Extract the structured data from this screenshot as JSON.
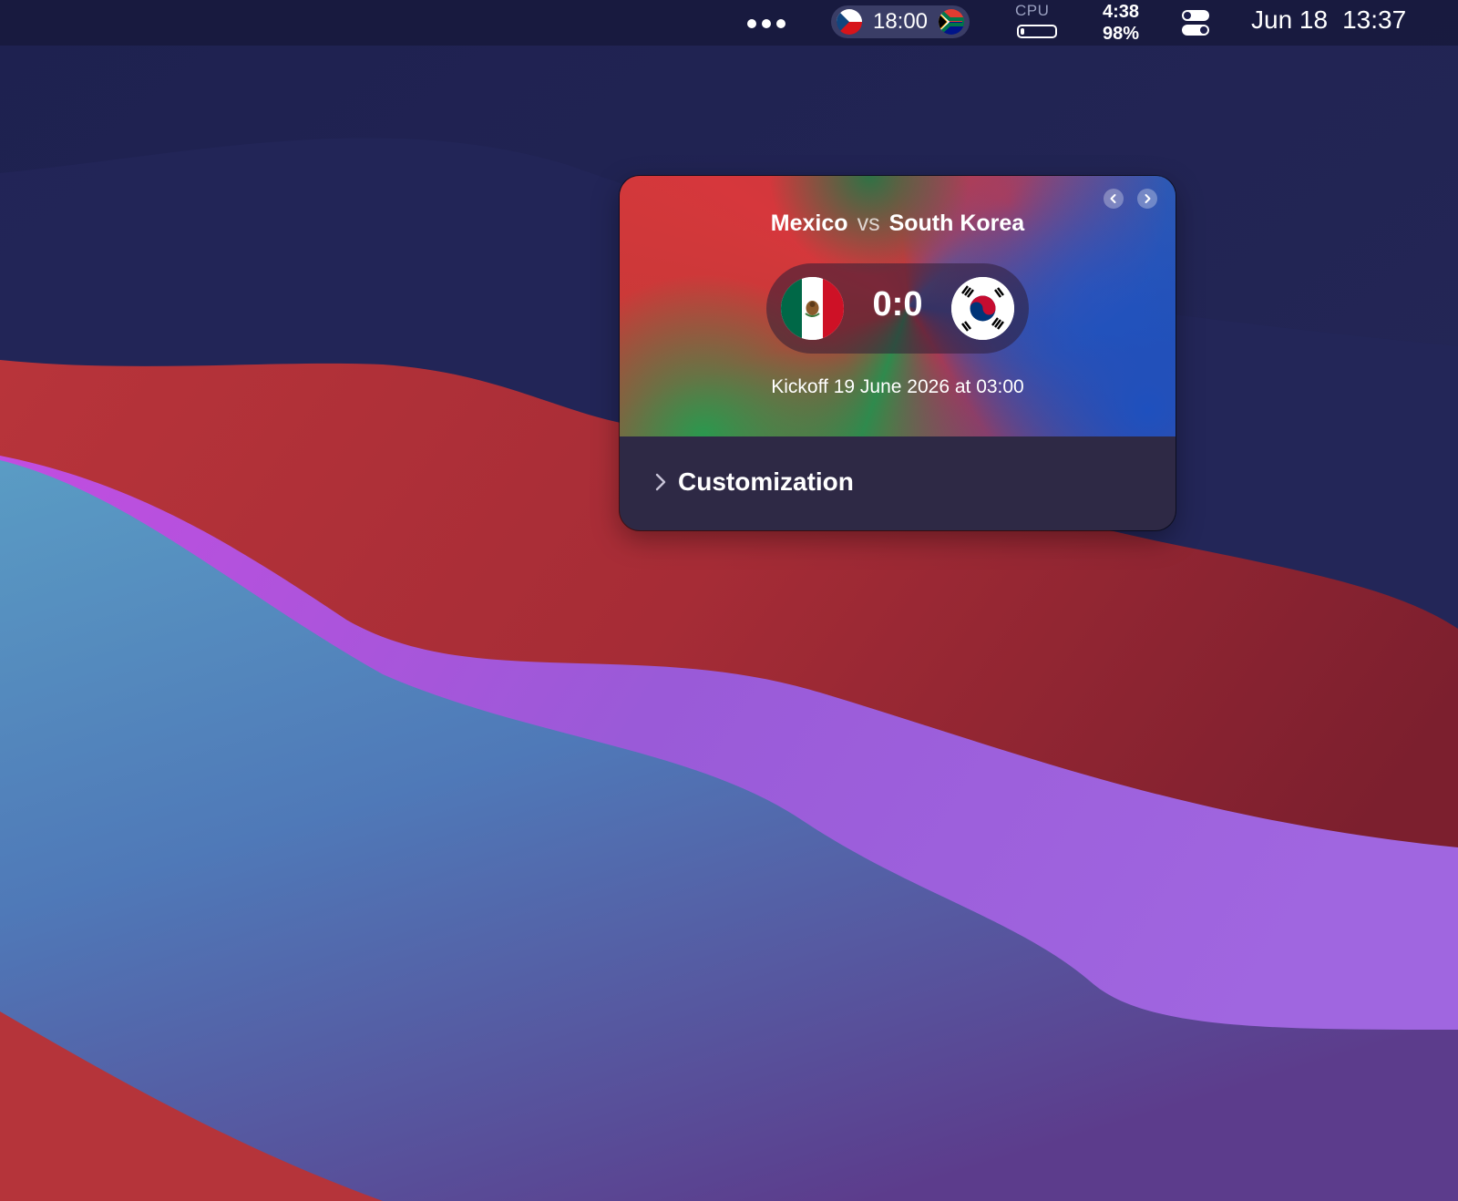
{
  "menubar": {
    "overflow_icon": "ellipsis-icon",
    "match": {
      "time": "18:00",
      "home_flag": "czech-flag-icon",
      "away_flag": "south-africa-flag-icon"
    },
    "cpu": {
      "label": "CPU",
      "usage": 0.08
    },
    "battery": {
      "time_remaining": "4:38",
      "percent": "98%"
    },
    "control_center_icon": "control-center-icon",
    "date": "Jun 18",
    "time": "13:37"
  },
  "widget": {
    "home_team": "Mexico",
    "vs_label": "vs",
    "away_team": "South Korea",
    "home_flag": "mexico-flag-icon",
    "away_flag": "south-korea-flag-icon",
    "score": "0:0",
    "kickoff": "Kickoff 19 June 2026 at 03:00",
    "prev_icon": "chevron-left-icon",
    "next_icon": "chevron-right-icon",
    "customization_label": "Customization",
    "colors": {
      "mexico_green": "#2f8a4d",
      "red": "#c53a36",
      "korea_blue": "#2a4fa6"
    }
  }
}
